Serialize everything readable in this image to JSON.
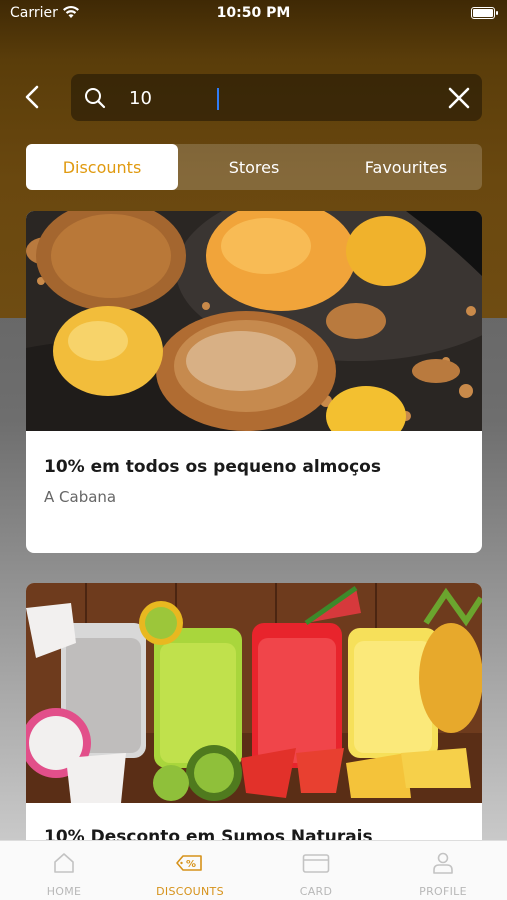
{
  "status_bar": {
    "carrier": "Carrier",
    "time": "10:50 PM"
  },
  "search": {
    "query": "10",
    "placeholder": ""
  },
  "segments": [
    {
      "label": "Discounts",
      "active": true
    },
    {
      "label": "Stores",
      "active": false
    },
    {
      "label": "Favourites",
      "active": false
    }
  ],
  "cards": [
    {
      "title": "10% em todos os pequeno almoços",
      "store": "A Cabana",
      "image": "dessert-photo"
    },
    {
      "title": "10% Desconto em Sumos Naturais",
      "image": "juices-photo"
    }
  ],
  "tab_bar": {
    "items": [
      {
        "label": "HOME",
        "icon": "home-icon",
        "active": false
      },
      {
        "label": "DISCOUNTS",
        "icon": "discount-tag-icon",
        "active": true
      },
      {
        "label": "CARD",
        "icon": "card-icon",
        "active": false
      },
      {
        "label": "PROFILE",
        "icon": "profile-icon",
        "active": false
      }
    ]
  },
  "colors": {
    "accent": "#e09a10",
    "header": "#6a480f",
    "background": "#5f5f5f"
  }
}
